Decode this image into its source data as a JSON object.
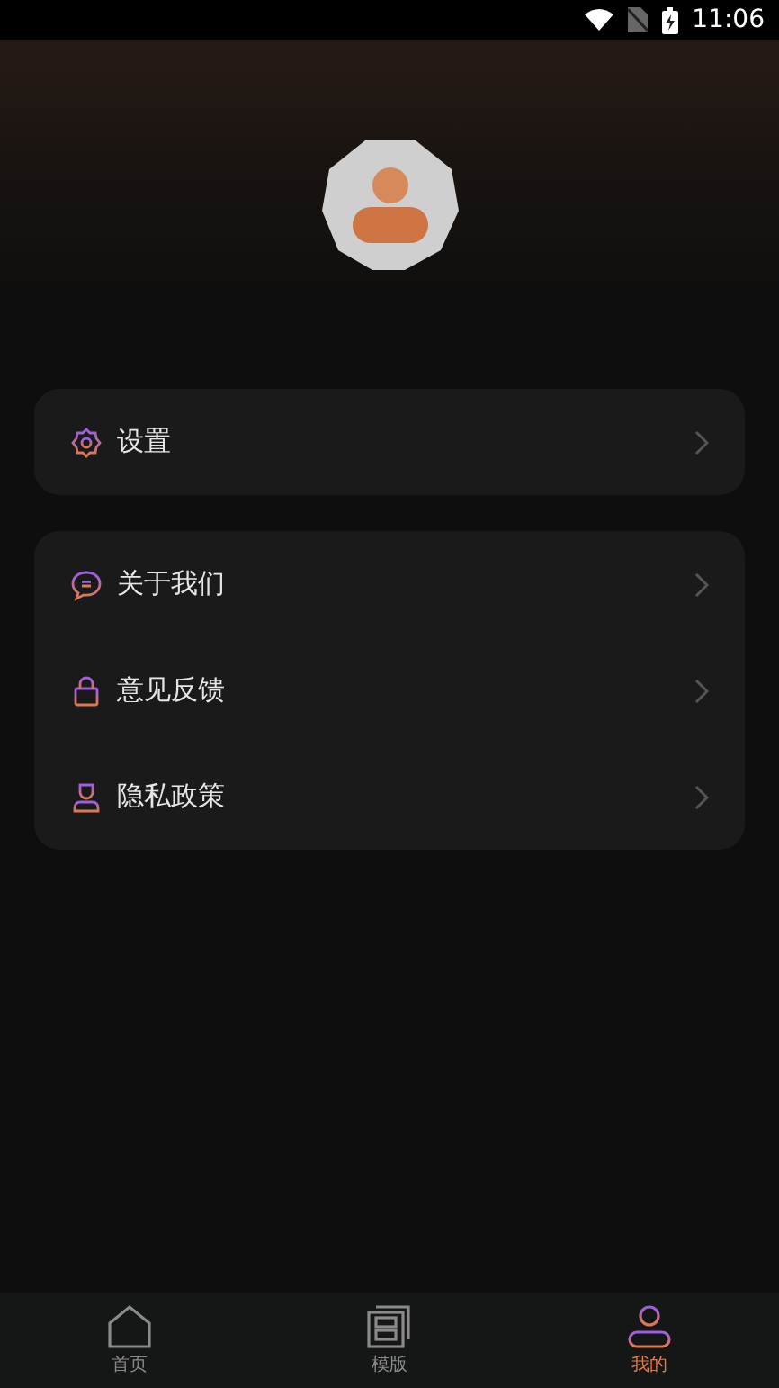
{
  "status_bar": {
    "time": "11:06"
  },
  "menu_groups": [
    {
      "items": [
        {
          "kind": "settings",
          "label": "设置"
        }
      ]
    },
    {
      "items": [
        {
          "kind": "about",
          "label": "关于我们"
        },
        {
          "kind": "feedback",
          "label": "意见反馈"
        },
        {
          "kind": "privacy",
          "label": "隐私政策"
        }
      ]
    }
  ],
  "tabs": [
    {
      "kind": "home",
      "label": "首页",
      "selected": false
    },
    {
      "kind": "template",
      "label": "模版",
      "selected": false
    },
    {
      "kind": "mine",
      "label": "我的",
      "selected": true
    }
  ]
}
